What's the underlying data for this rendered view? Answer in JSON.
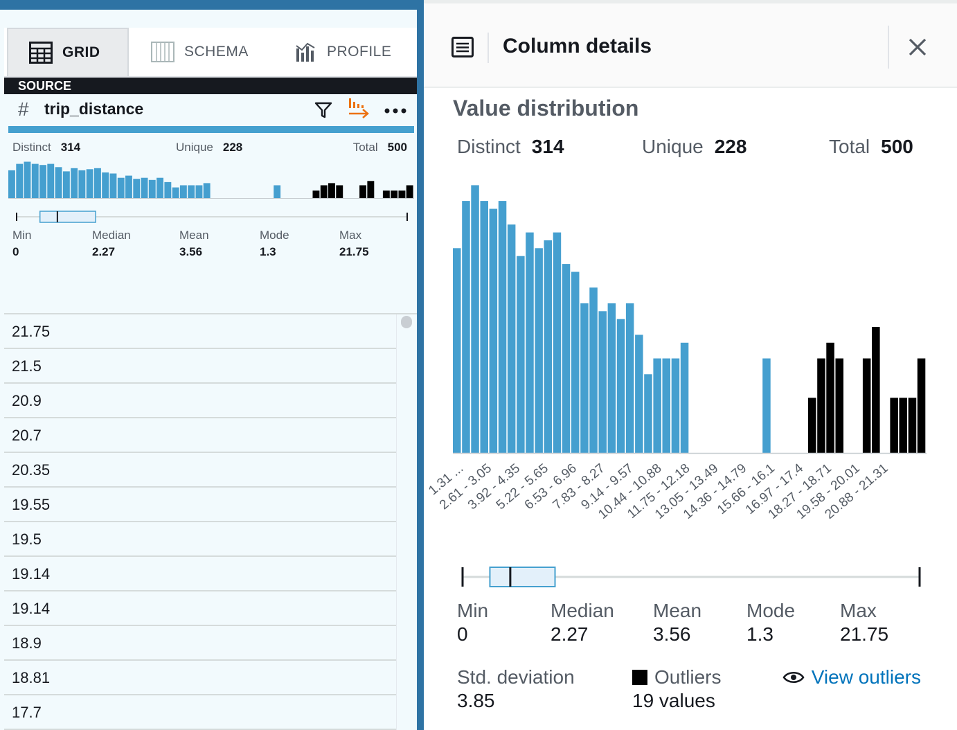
{
  "left": {
    "tabs": [
      {
        "label": "GRID",
        "icon": "grid-icon",
        "active": true
      },
      {
        "label": "SCHEMA",
        "icon": "schema-icon",
        "active": false
      },
      {
        "label": "PROFILE",
        "icon": "profile-icon",
        "active": false
      }
    ],
    "source_label": "SOURCE",
    "column": {
      "type_symbol": "#",
      "name": "trip_distance"
    },
    "mini_stats": {
      "distinct_label": "Distinct",
      "distinct": "314",
      "unique_label": "Unique",
      "unique": "228",
      "total_label": "Total",
      "total": "500"
    },
    "summary": [
      {
        "label": "Min",
        "value": "0"
      },
      {
        "label": "Median",
        "value": "2.27"
      },
      {
        "label": "Mean",
        "value": "3.56"
      },
      {
        "label": "Mode",
        "value": "1.3"
      },
      {
        "label": "Max",
        "value": "21.75"
      }
    ],
    "rows": [
      "21.75",
      "21.5",
      "20.9",
      "20.7",
      "20.35",
      "19.55",
      "19.5",
      "19.14",
      "19.14",
      "18.9",
      "18.81",
      "17.7"
    ]
  },
  "right": {
    "title": "Column details",
    "section_title": "Value distribution",
    "stats": {
      "distinct_label": "Distinct",
      "distinct": "314",
      "unique_label": "Unique",
      "unique": "228",
      "total_label": "Total",
      "total": "500"
    },
    "summary": [
      {
        "label": "Min",
        "value": "0"
      },
      {
        "label": "Median",
        "value": "2.27"
      },
      {
        "label": "Mean",
        "value": "3.56"
      },
      {
        "label": "Mode",
        "value": "1.3"
      },
      {
        "label": "Max",
        "value": "21.75"
      }
    ],
    "std_label": "Std. deviation",
    "std_value": "3.85",
    "outliers_label": "Outliers",
    "outliers_value": "19 values",
    "view_outliers": "View outliers"
  },
  "colors": {
    "bar": "#459fcf",
    "outlier": "#000000",
    "accent": "#2e73a4",
    "link": "#0073bb"
  },
  "chart_data": {
    "type": "bar",
    "tick_labels": [
      "1.31 ...",
      "2.61 - 3.05",
      "3.92 - 4.35",
      "5.22 - 5.65",
      "6.53 - 6.96",
      "7.83 - 8.27",
      "9.14 - 9.57",
      "10.44 - 10.88",
      "11.75 - 12.18",
      "13.05 - 13.49",
      "14.36 - 14.79",
      "15.66 - 16.1",
      "16.97 - 17.4",
      "18.27 - 18.71",
      "19.58 - 20.01",
      "20.88 - 21.31"
    ],
    "bins": 50,
    "values": [
      13,
      16,
      17,
      16,
      15.5,
      16,
      14.5,
      12.5,
      14,
      13,
      13.5,
      14,
      12,
      11.5,
      9.5,
      10.5,
      9,
      9.5,
      8.5,
      9.5,
      7.5,
      5,
      6,
      6,
      6,
      7,
      0,
      0,
      0,
      0,
      0,
      0,
      0,
      0,
      6,
      0,
      0,
      0,
      0,
      3.5,
      6,
      7,
      6,
      0,
      0,
      6,
      8,
      0,
      3.5,
      3.5,
      3.5,
      6
    ],
    "outlier_from_index": 39,
    "ylim": [
      0,
      17.5
    ],
    "box": {
      "min": 0,
      "q1": 1.3,
      "median": 2.27,
      "q3": 4.4,
      "max": 21.75
    },
    "grid": false,
    "legend": "none"
  }
}
